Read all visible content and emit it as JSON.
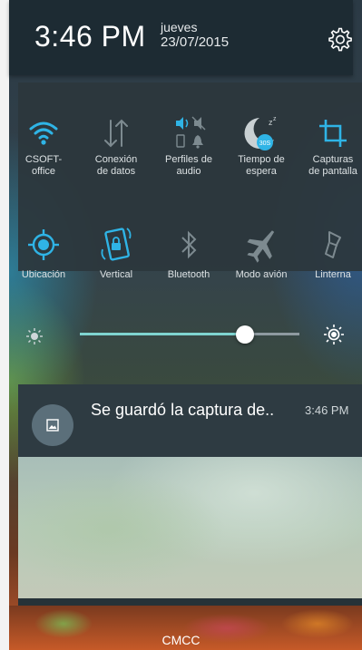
{
  "status": {
    "time": "3:46 PM",
    "day": "jueves",
    "date": "23/07/2015",
    "settings_icon": "gear-icon"
  },
  "quick_settings": {
    "row1": [
      {
        "label_l1": "CSOFT-",
        "label_l2": "office",
        "icon": "wifi-icon",
        "active": true
      },
      {
        "label_l1": "Conexión",
        "label_l2": "de datos",
        "icon": "data-arrows-icon",
        "active": false
      },
      {
        "label_l1": "Perfiles de",
        "label_l2": "audio",
        "icon": "audio-profiles-icon",
        "active": true
      },
      {
        "label_l1": "Tiempo de",
        "label_l2": "espera",
        "icon": "sleep-moon-icon",
        "active": true,
        "badge": "30S"
      },
      {
        "label_l1": "Capturas",
        "label_l2": "de pantalla",
        "icon": "crop-icon",
        "active": true
      }
    ],
    "row2": [
      {
        "label": "Ubicación",
        "icon": "location-icon",
        "active": true
      },
      {
        "label": "Vertical",
        "icon": "rotation-lock-icon",
        "active": true
      },
      {
        "label": "Bluetooth",
        "icon": "bluetooth-icon",
        "active": false
      },
      {
        "label": "Modo avión",
        "icon": "airplane-icon",
        "active": false
      },
      {
        "label": "Linterna",
        "icon": "flashlight-icon",
        "active": false
      }
    ],
    "brightness_level": 0.75
  },
  "notification": {
    "title": "Se guardó la captura de..",
    "time": "3:46 PM",
    "icon": "image-icon"
  },
  "carrier": "CMCC",
  "colors": {
    "accent": "#2fb4e6",
    "inactive": "#7d8a90",
    "header_bg": "#1d2b33",
    "panel_bg": "#2c373c",
    "slider_fill": "#7fd4d0"
  }
}
